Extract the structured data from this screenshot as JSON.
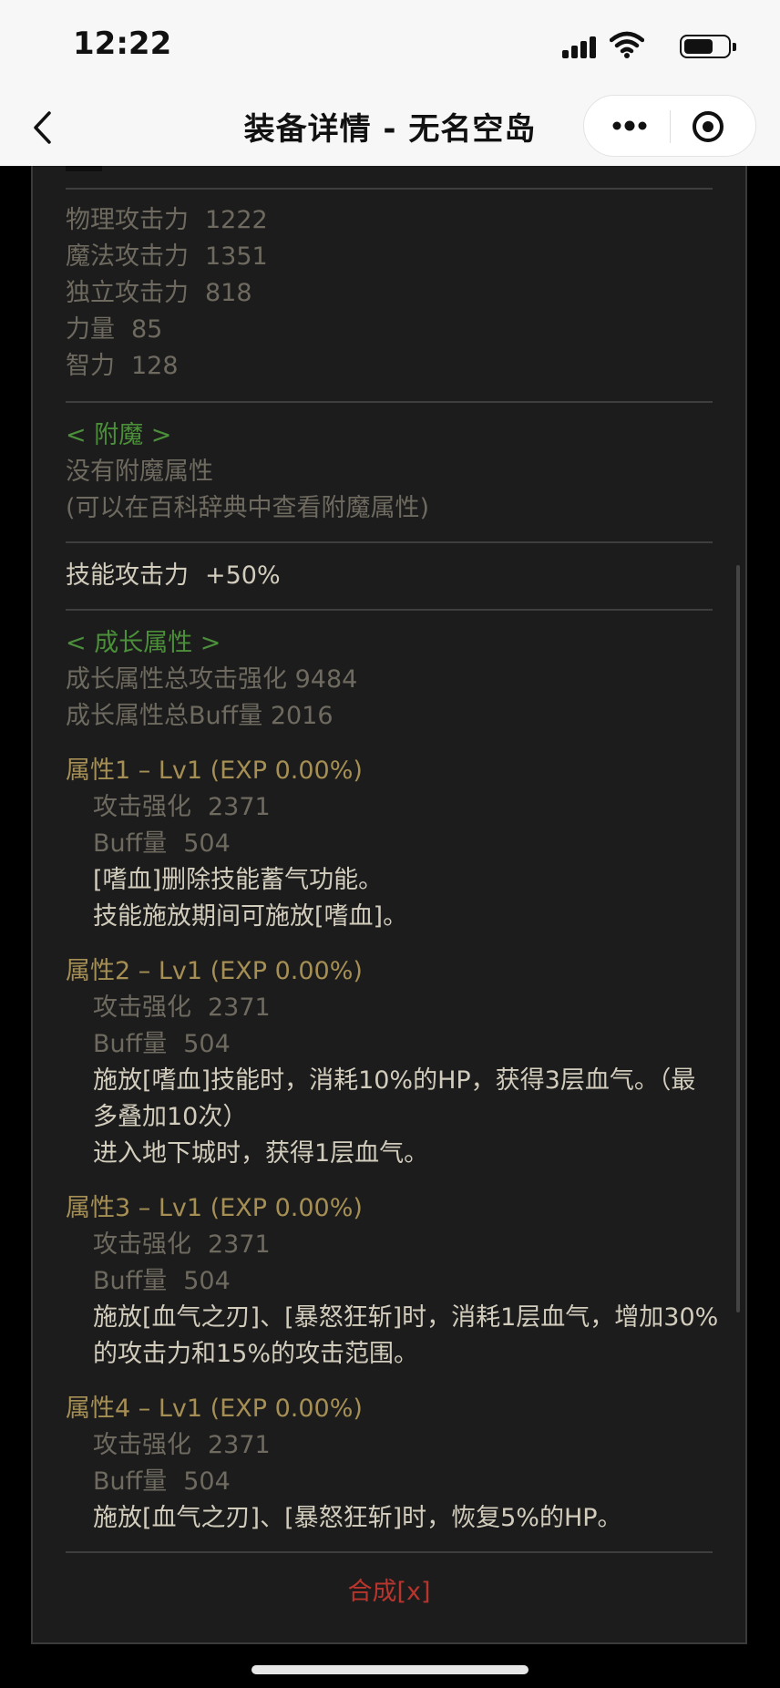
{
  "status_bar": {
    "time": "12:22"
  },
  "nav": {
    "title": "装备详情 - 无名空岛"
  },
  "stats": [
    {
      "label": "物理攻击力",
      "value": "1222"
    },
    {
      "label": "魔法攻击力",
      "value": "1351"
    },
    {
      "label": "独立攻击力",
      "value": "818"
    },
    {
      "label": "力量",
      "value": "85"
    },
    {
      "label": "智力",
      "value": "128"
    }
  ],
  "enchant": {
    "header": "< 附魔 >",
    "none": "没有附魔属性",
    "hint": "(可以在百科辞典中查看附魔属性)"
  },
  "skill_attack": {
    "label": "技能攻击力",
    "value": "+50%"
  },
  "growth": {
    "header": "< 成长属性 >",
    "total_attack": "成长属性总攻击强化 9484",
    "total_buff": "成长属性总Buff量 2016"
  },
  "attributes": [
    {
      "title": "属性1 – Lv1 (EXP 0.00%)",
      "attack_label": "攻击强化",
      "attack_value": "2371",
      "buff_label": "Buff量",
      "buff_value": "504",
      "desc1": "[嗜血]删除技能蓄气功能。",
      "desc2": "技能施放期间可施放[嗜血]。"
    },
    {
      "title": "属性2 – Lv1 (EXP 0.00%)",
      "attack_label": "攻击强化",
      "attack_value": "2371",
      "buff_label": "Buff量",
      "buff_value": "504",
      "desc1": "施放[嗜血]技能时，消耗10%的HP，获得3层血气。（最多叠加10次）",
      "desc2": "进入地下城时，获得1层血气。"
    },
    {
      "title": "属性3 – Lv1 (EXP 0.00%)",
      "attack_label": "攻击强化",
      "attack_value": "2371",
      "buff_label": "Buff量",
      "buff_value": "504",
      "desc1": "施放[血气之刃]、[暴怒狂斩]时，消耗1层血气，增加30%的攻击力和15%的攻击范围。"
    },
    {
      "title": "属性4 – Lv1 (EXP 0.00%)",
      "attack_label": "攻击强化",
      "attack_value": "2371",
      "buff_label": "Buff量",
      "buff_value": "504",
      "desc1": "施放[血气之刃]、[暴怒狂斩]时，恢复5%的HP。"
    }
  ],
  "compose_label": "合成[x]",
  "colors": {
    "panel_bg": "#1c1c1c",
    "stat_text": "#6e6a5f",
    "light_text": "#d2ccbd",
    "section_green": "#4b8f3a",
    "attr_gold": "#a68f54",
    "compose_red": "#b8352d"
  },
  "battery_level": 0.68
}
